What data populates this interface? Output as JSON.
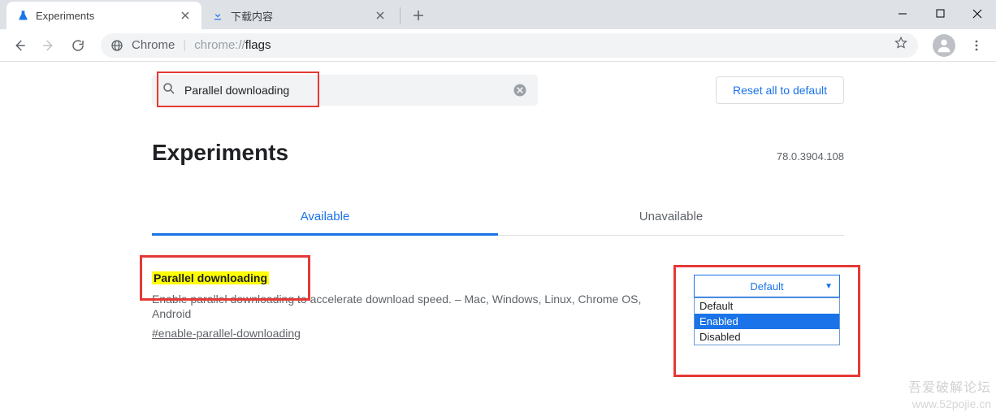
{
  "window": {
    "tabs": [
      {
        "title": "Experiments",
        "favicon": "flask",
        "active": true
      },
      {
        "title": "下载内容",
        "favicon": "download",
        "active": false
      }
    ]
  },
  "toolbar": {
    "omnibox_chrome_label": "Chrome",
    "omnibox_url_prefix": "chrome://",
    "omnibox_url_path": "flags"
  },
  "flags_page": {
    "search": {
      "value": "Parallel downloading",
      "placeholder": "Search flags"
    },
    "reset_label": "Reset all to default",
    "title": "Experiments",
    "version": "78.0.3904.108",
    "tabs": {
      "available": "Available",
      "unavailable": "Unavailable"
    },
    "experiment": {
      "title": "Parallel downloading",
      "desc_strike": "Enable parallel downloading",
      "desc_rest": " to accelerate download speed. – Mac, Windows, Linux, Chrome OS, Android",
      "hash": "#enable-parallel-downloading",
      "selected": "Default",
      "options": [
        "Default",
        "Enabled",
        "Disabled"
      ],
      "highlighted_option": "Enabled"
    }
  },
  "watermark": {
    "line1": "吾爱破解论坛",
    "line2": "www.52pojie.cn"
  }
}
